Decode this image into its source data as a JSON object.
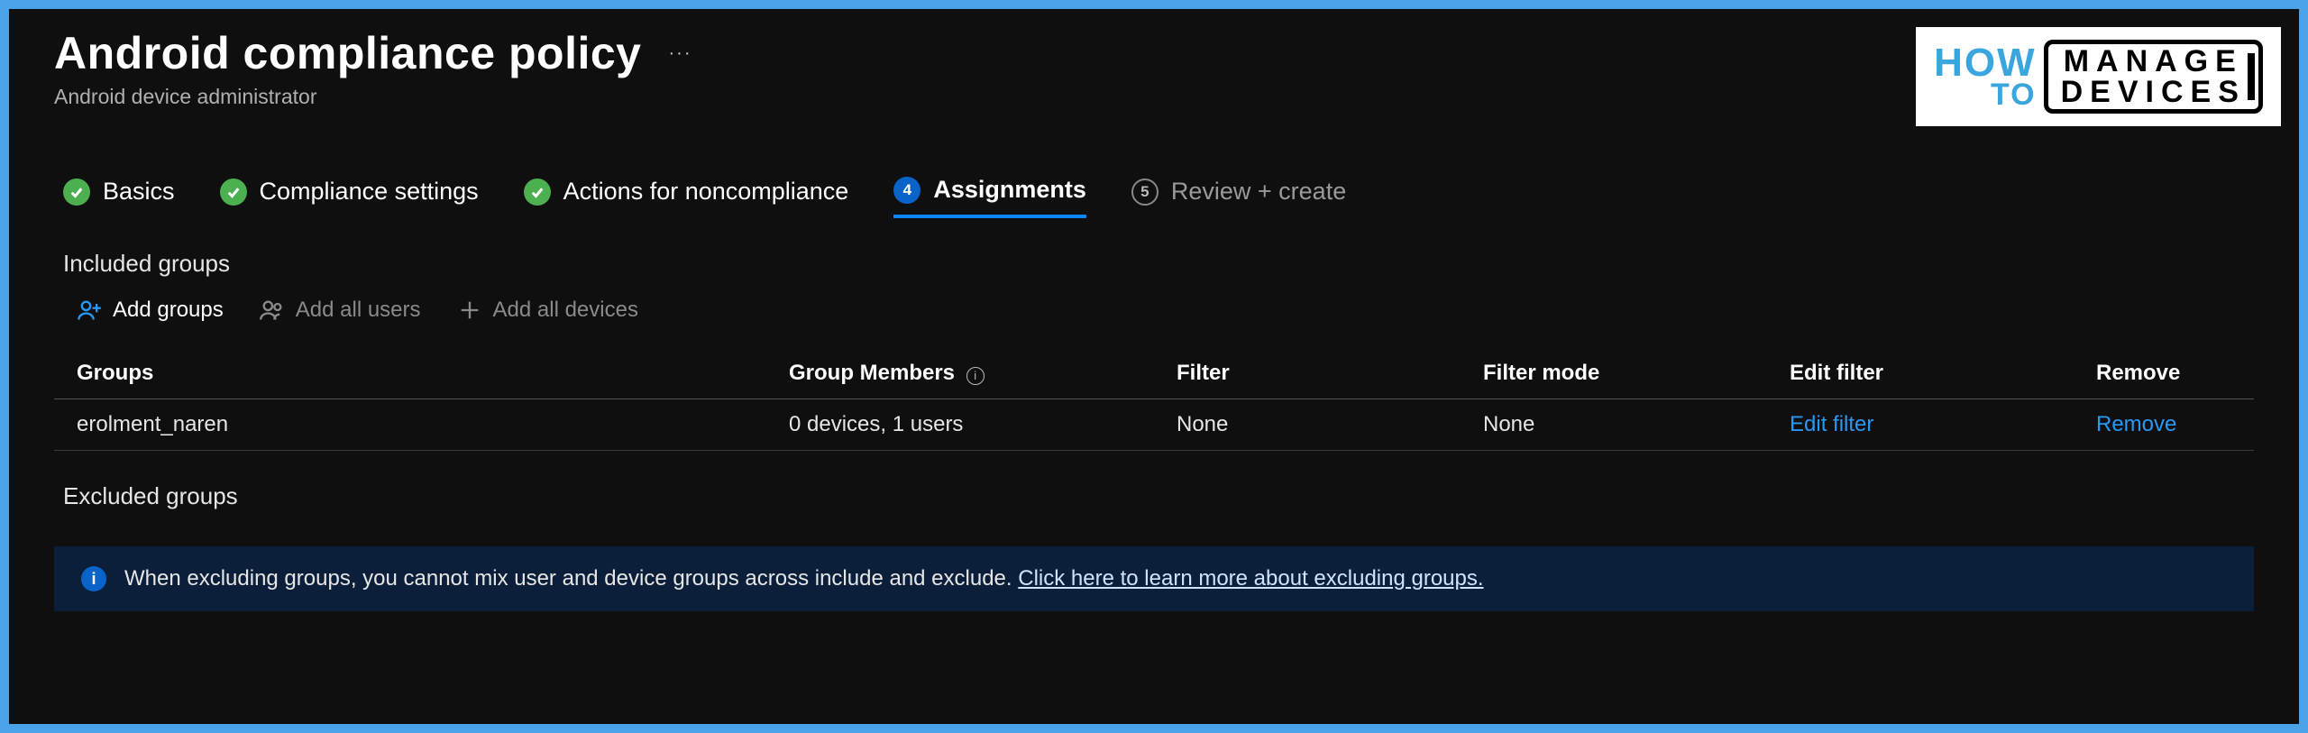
{
  "header": {
    "title": "Android compliance policy",
    "subtitle": "Android device administrator",
    "more": "···"
  },
  "logo": {
    "how": "HOW",
    "to": "TO",
    "line1": "MANAGE",
    "line2": "DEVICES"
  },
  "wizard": {
    "steps": [
      {
        "label": "Basics"
      },
      {
        "label": "Compliance settings"
      },
      {
        "label": "Actions for noncompliance"
      },
      {
        "num": "4",
        "label": "Assignments"
      },
      {
        "num": "5",
        "label": "Review + create"
      }
    ]
  },
  "sections": {
    "included": "Included groups",
    "excluded": "Excluded groups"
  },
  "toolbar": {
    "add_groups": "Add groups",
    "add_all_users": "Add all users",
    "add_all_devices": "Add all devices"
  },
  "table": {
    "headers": {
      "groups": "Groups",
      "members": "Group Members",
      "filter": "Filter",
      "filter_mode": "Filter mode",
      "edit_filter": "Edit filter",
      "remove": "Remove"
    },
    "rows": [
      {
        "group": "erolment_naren",
        "members": "0 devices, 1 users",
        "filter": "None",
        "filter_mode": "None",
        "edit_filter": "Edit filter",
        "remove": "Remove"
      }
    ]
  },
  "banner": {
    "text": "When excluding groups, you cannot mix user and device groups across include and exclude. ",
    "link": "Click here to learn more about excluding groups."
  }
}
